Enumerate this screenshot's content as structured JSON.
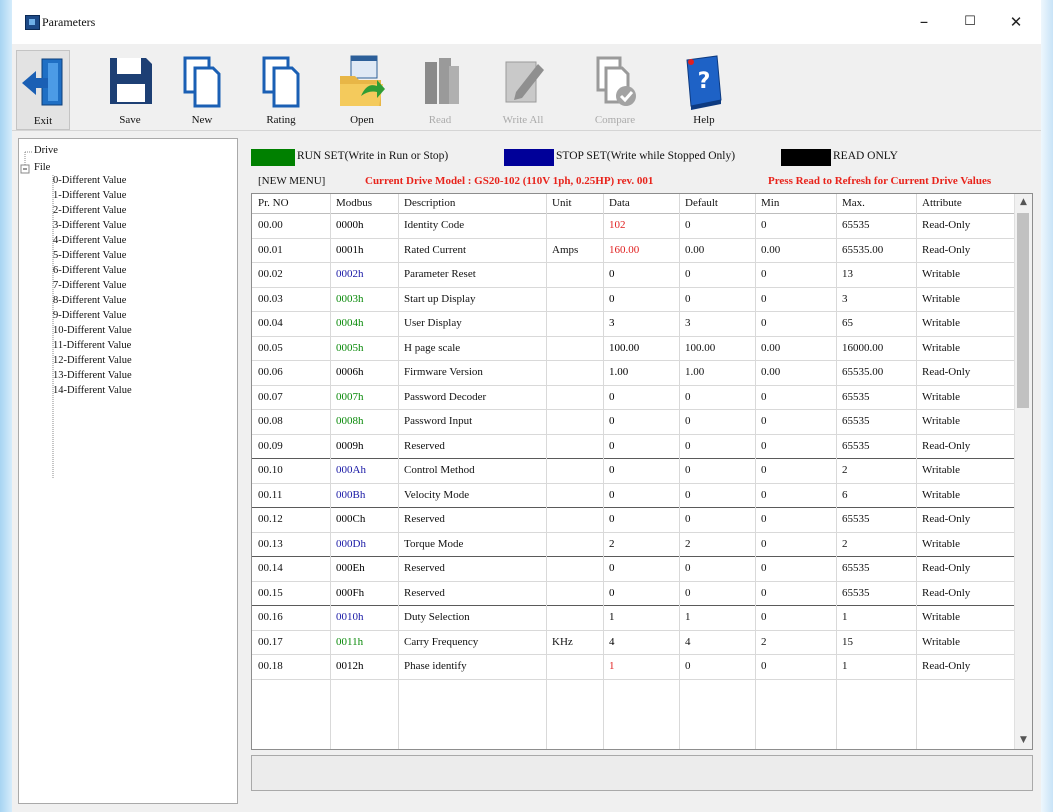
{
  "window": {
    "title": "Parameters"
  },
  "window_controls": {
    "minimize": "–",
    "maximize": "☐",
    "close": "✕"
  },
  "toolbar": {
    "exit": "Exit",
    "save": "Save",
    "new": "New",
    "rating": "Rating",
    "open": "Open",
    "read": "Read",
    "write_all": "Write All",
    "compare": "Compare",
    "help": "Help"
  },
  "tree": {
    "drive": "Drive",
    "file": "File",
    "children": [
      "0-Different Value",
      "1-Different Value",
      "2-Different Value",
      "3-Different Value",
      "4-Different Value",
      "5-Different Value",
      "6-Different Value",
      "7-Different Value",
      "8-Different Value",
      "9-Different Value",
      "10-Different Value",
      "11-Different Value",
      "12-Different Value",
      "13-Different Value",
      "14-Different Value"
    ]
  },
  "legend": {
    "run_set": "RUN SET(Write in Run or Stop)",
    "stop_set": "STOP SET(Write while Stopped Only)",
    "read_only": "READ ONLY",
    "run_color": "#008000",
    "stop_color": "#000099",
    "readonly_color": "#000000"
  },
  "info": {
    "menu": "[NEW MENU]",
    "drive_model": "Current Drive Model : GS20-102 (110V 1ph, 0.25HP) rev. 001",
    "refresh_hint": "Press Read to Refresh for Current Drive Values"
  },
  "table": {
    "headers": [
      "Pr. NO",
      "Modbus",
      "Description",
      "Unit",
      "Data",
      "Default",
      "Min",
      "Max.",
      "Attribute"
    ],
    "rows": [
      {
        "pr": "00.00",
        "modbus": "0000h",
        "desc": "Identity Code",
        "unit": "",
        "data": "102",
        "def": "0",
        "min": "0",
        "max": "65535",
        "attr": "Read-Only",
        "mcolor": "#000000",
        "dcolor": "#e02020"
      },
      {
        "pr": "00.01",
        "modbus": "0001h",
        "desc": "Rated Current",
        "unit": "Amps",
        "data": "160.00",
        "def": "0.00",
        "min": "0.00",
        "max": "65535.00",
        "attr": "Read-Only",
        "mcolor": "#000000",
        "dcolor": "#e02020"
      },
      {
        "pr": "00.02",
        "modbus": "0002h",
        "desc": "Parameter Reset",
        "unit": "",
        "data": "0",
        "def": "0",
        "min": "0",
        "max": "13",
        "attr": "Writable",
        "mcolor": "#1a1aa6",
        "dcolor": "#000000"
      },
      {
        "pr": "00.03",
        "modbus": "0003h",
        "desc": "Start up Display",
        "unit": "",
        "data": "0",
        "def": "0",
        "min": "0",
        "max": "3",
        "attr": "Writable",
        "mcolor": "#0a8a0a",
        "dcolor": "#000000"
      },
      {
        "pr": "00.04",
        "modbus": "0004h",
        "desc": "User Display",
        "unit": "",
        "data": "3",
        "def": "3",
        "min": "0",
        "max": "65",
        "attr": "Writable",
        "mcolor": "#0a8a0a",
        "dcolor": "#000000"
      },
      {
        "pr": "00.05",
        "modbus": "0005h",
        "desc": "H page scale",
        "unit": "",
        "data": "100.00",
        "def": "100.00",
        "min": "0.00",
        "max": "16000.00",
        "attr": "Writable",
        "mcolor": "#0a8a0a",
        "dcolor": "#000000"
      },
      {
        "pr": "00.06",
        "modbus": "0006h",
        "desc": "Firmware Version",
        "unit": "",
        "data": "1.00",
        "def": "1.00",
        "min": "0.00",
        "max": "65535.00",
        "attr": "Read-Only",
        "mcolor": "#000000",
        "dcolor": "#000000"
      },
      {
        "pr": "00.07",
        "modbus": "0007h",
        "desc": "Password Decoder",
        "unit": "",
        "data": "0",
        "def": "0",
        "min": "0",
        "max": "65535",
        "attr": "Writable",
        "mcolor": "#0a8a0a",
        "dcolor": "#000000"
      },
      {
        "pr": "00.08",
        "modbus": "0008h",
        "desc": "Password Input",
        "unit": "",
        "data": "0",
        "def": "0",
        "min": "0",
        "max": "65535",
        "attr": "Writable",
        "mcolor": "#0a8a0a",
        "dcolor": "#000000"
      },
      {
        "pr": "00.09",
        "modbus": "0009h",
        "desc": "Reserved",
        "unit": "",
        "data": "0",
        "def": "0",
        "min": "0",
        "max": "65535",
        "attr": "Read-Only",
        "mcolor": "#000000",
        "dcolor": "#000000"
      },
      {
        "pr": "00.10",
        "modbus": "000Ah",
        "desc": "Control Method",
        "unit": "",
        "data": "0",
        "def": "0",
        "min": "0",
        "max": "2",
        "attr": "Writable",
        "mcolor": "#1a1aa6",
        "dcolor": "#000000"
      },
      {
        "pr": "00.11",
        "modbus": "000Bh",
        "desc": "Velocity Mode",
        "unit": "",
        "data": "0",
        "def": "0",
        "min": "0",
        "max": "6",
        "attr": "Writable",
        "mcolor": "#1a1aa6",
        "dcolor": "#000000"
      },
      {
        "pr": "00.12",
        "modbus": "000Ch",
        "desc": "Reserved",
        "unit": "",
        "data": "0",
        "def": "0",
        "min": "0",
        "max": "65535",
        "attr": "Read-Only",
        "mcolor": "#000000",
        "dcolor": "#000000"
      },
      {
        "pr": "00.13",
        "modbus": "000Dh",
        "desc": "Torque Mode",
        "unit": "",
        "data": "2",
        "def": "2",
        "min": "0",
        "max": "2",
        "attr": "Writable",
        "mcolor": "#1a1aa6",
        "dcolor": "#000000"
      },
      {
        "pr": "00.14",
        "modbus": "000Eh",
        "desc": "Reserved",
        "unit": "",
        "data": "0",
        "def": "0",
        "min": "0",
        "max": "65535",
        "attr": "Read-Only",
        "mcolor": "#000000",
        "dcolor": "#000000"
      },
      {
        "pr": "00.15",
        "modbus": "000Fh",
        "desc": "Reserved",
        "unit": "",
        "data": "0",
        "def": "0",
        "min": "0",
        "max": "65535",
        "attr": "Read-Only",
        "mcolor": "#000000",
        "dcolor": "#000000"
      },
      {
        "pr": "00.16",
        "modbus": "0010h",
        "desc": "Duty Selection",
        "unit": "",
        "data": "1",
        "def": "1",
        "min": "0",
        "max": "1",
        "attr": "Writable",
        "mcolor": "#1a1aa6",
        "dcolor": "#000000"
      },
      {
        "pr": "00.17",
        "modbus": "0011h",
        "desc": "Carry Frequency",
        "unit": "KHz",
        "data": "4",
        "def": "4",
        "min": "2",
        "max": "15",
        "attr": "Writable",
        "mcolor": "#0a8a0a",
        "dcolor": "#000000"
      },
      {
        "pr": "00.18",
        "modbus": "0012h",
        "desc": "Phase identify",
        "unit": "",
        "data": "1",
        "def": "0",
        "min": "0",
        "max": "1",
        "attr": "Read-Only",
        "mcolor": "#000000",
        "dcolor": "#e02020"
      }
    ]
  },
  "colors": {
    "info_red": "#e8231b"
  }
}
